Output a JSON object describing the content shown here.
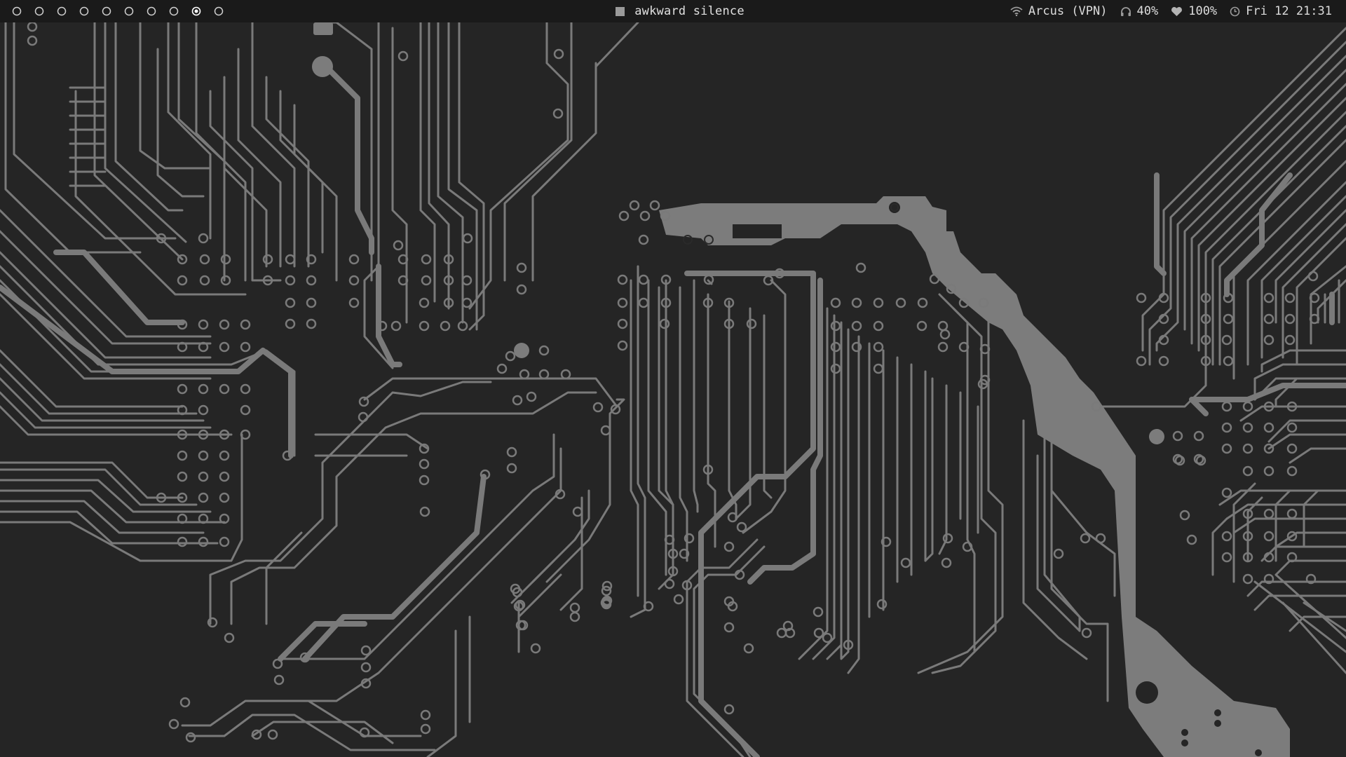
{
  "bar": {
    "workspaces": [
      {
        "icon": "circle-outline-icon",
        "active": false
      },
      {
        "icon": "circle-outline-icon",
        "active": false
      },
      {
        "icon": "circle-outline-icon",
        "active": false
      },
      {
        "icon": "circle-outline-icon",
        "active": false
      },
      {
        "icon": "circle-outline-icon",
        "active": false
      },
      {
        "icon": "circle-outline-icon",
        "active": false
      },
      {
        "icon": "circle-outline-icon",
        "active": false
      },
      {
        "icon": "circle-outline-icon",
        "active": false
      },
      {
        "icon": "circle-dot-icon",
        "active": true
      },
      {
        "icon": "circle-outline-icon",
        "active": false
      }
    ],
    "window_title": "awkward silence",
    "network": {
      "icon": "wifi-icon",
      "label": "Arcus (VPN)"
    },
    "volume": {
      "icon": "headphones-icon",
      "label": "40%"
    },
    "battery": {
      "icon": "heart-icon",
      "label": "100%"
    },
    "clock": {
      "icon": "clock-icon",
      "label": "Fri 12 21:31"
    }
  },
  "colors": {
    "bar_background": "#1a1a1a",
    "wallpaper_background": "#252525",
    "trace": "#7c7c7c",
    "text": "#dcdcdc"
  }
}
